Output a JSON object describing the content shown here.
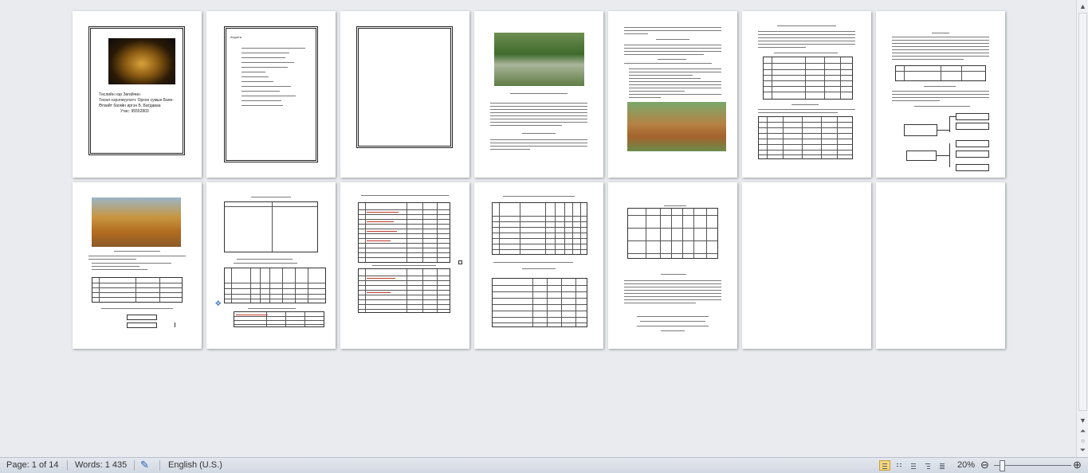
{
  "status_bar": {
    "page": "Page: 1 of 14",
    "words": "Words: 1 435",
    "language": "English (U.S.)",
    "zoom": "20%"
  },
  "icons": {
    "proofing": "proofing-check-icon",
    "print_layout": "print-layout-view-icon",
    "full_screen": "full-screen-reading-view-icon",
    "web_layout": "web-layout-view-icon",
    "outline": "outline-view-icon",
    "draft": "draft-view-icon",
    "zoom_out": "zoom-out-icon",
    "zoom_in": "zoom-in-icon"
  },
  "colors": {
    "status_bar": "#d6dce6",
    "active_view": "#f6d77a",
    "highlight": "#c0392b"
  },
  "pages": {
    "total": 14,
    "cover": {
      "line1": "Төслийн нэр Зөгийчин",
      "line2": "Төсөл хэрэгжүүлэгч: Орхон сумын Баян-",
      "line3": "Өлзийт багийн иргэн Б. Батдаваа",
      "line4": "Утас: 95552803"
    },
    "toc_title": "Агуулга"
  }
}
